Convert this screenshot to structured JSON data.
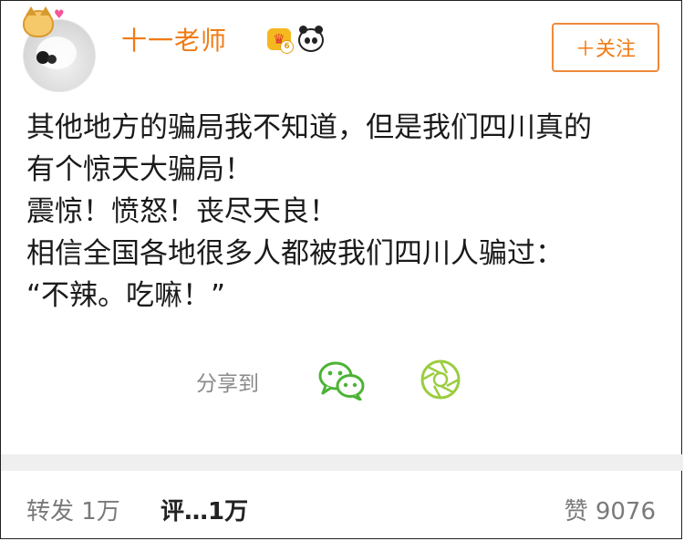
{
  "user": {
    "name": "十一老师",
    "badges": [
      "crown-icon",
      "panda-icon"
    ],
    "crown_level": "6",
    "follow_label": "＋关注"
  },
  "post": {
    "lines": [
      "其他地方的骗局我不知道，但是我们四川真的",
      "有个惊天大骗局！",
      "震惊！愤怒！丧尽天良！",
      "相信全国各地很多人都被我们四川人骗过：",
      "“不辣。吃嘛！”"
    ]
  },
  "share": {
    "label": "分享到",
    "targets": [
      "wechat-icon",
      "wechat-moments-icon"
    ],
    "wechat_color": "#4cb335",
    "moments_color": "#9bcd3f"
  },
  "stats": {
    "repost": "转发 1万",
    "comment": "评…1万",
    "like": "赞 9076"
  },
  "colors": {
    "accent": "#f07b14",
    "muted": "#8a8a8a"
  }
}
